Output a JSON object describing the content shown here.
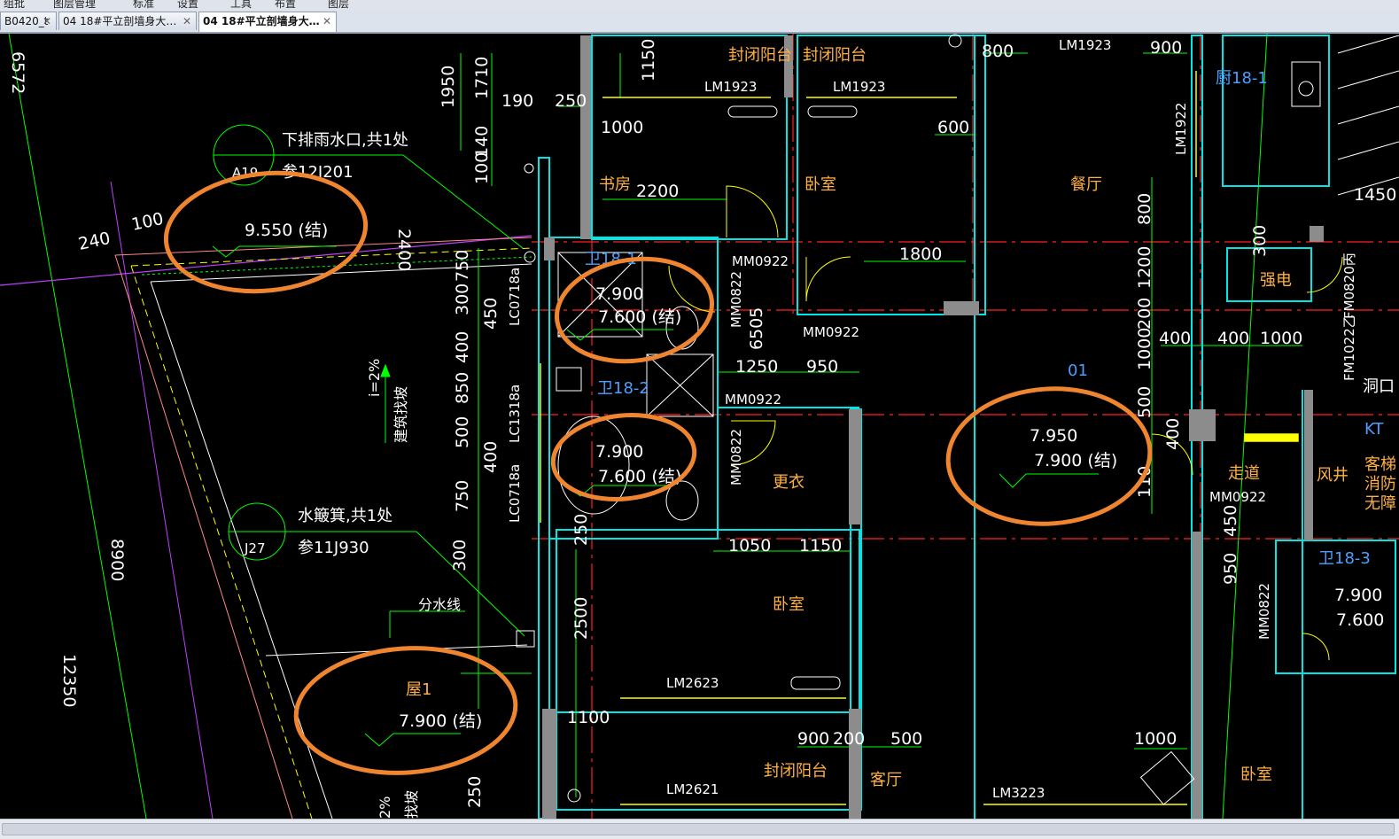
{
  "menu": [
    "组批",
    "图层管理",
    "标准",
    "设置",
    "工具",
    "布置",
    "图层"
  ],
  "tabs": [
    {
      "label": "B0420_t"
    },
    {
      "label": "04 18#平立剖墙身大…"
    },
    {
      "label": "04 18#平立剖墙身大…"
    }
  ],
  "tab_close_glyph": "✕",
  "drawing": {
    "dims": {
      "d6572": "6572",
      "d1950": "1950",
      "d1710": "1710",
      "d190": "190",
      "d250a": "250",
      "d1150": "1150",
      "d1000a": "1000",
      "d140": "140",
      "d100a": "100",
      "d2200": "2200",
      "d240": "240",
      "d100b": "100",
      "d2400": "2400",
      "d750a": "750",
      "d300a": "300",
      "d450": "450",
      "d400a": "400",
      "d850": "850",
      "d500a": "500",
      "d400b": "400",
      "d750b": "750",
      "d8900": "8900",
      "d12350": "12350",
      "d300b": "300",
      "d250b": "250",
      "d2500": "2500",
      "d1100": "1100",
      "d250c": "250",
      "d6505": "6505",
      "d1250": "1250",
      "d950a": "950",
      "d1800": "1800",
      "d800a": "800",
      "d900a": "900",
      "d600": "600",
      "d800b": "800",
      "d1200": "1200",
      "d200": "200",
      "d1000b": "1000",
      "d500b": "500",
      "d400c": "400",
      "d400d": "400",
      "d1000c": "1000",
      "d400e": "400",
      "d110": "110",
      "d1050": "1050",
      "d1150b": "1150",
      "d900b": "900",
      "d200b": "200",
      "d500c": "500",
      "d1000d": "1000",
      "d1450": "1450",
      "d450b": "450",
      "d950b": "950",
      "d300c": "300"
    },
    "doors": {
      "lm1923a": "LM1923",
      "lm1923b": "LM1923",
      "lm1923c": "LM1923",
      "mm0922a": "MM0922",
      "mm0922b": "MM0922",
      "mm0922c": "MM0922",
      "mm0922d": "MM0922",
      "mm0822a": "MM0822",
      "mm0822b": "MM0822",
      "mm0822c": "MM0822",
      "lc0718a": "LC0718a",
      "lc1318a": "LC1318a",
      "lc0718b": "LC0718a",
      "lm2623": "LM2623",
      "lm2621": "LM2621",
      "lm3223": "LM3223",
      "lm1922": "LM1922",
      "fm0820": "FM0820丙",
      "fm1022": "FM1022乙"
    },
    "rooms": {
      "balcony1": "封闭阳台",
      "balcony2": "封闭阳台",
      "balcony3": "封闭阳台",
      "study": "书房",
      "bedroom1": "卧室",
      "dining": "餐厅",
      "dressing": "更衣",
      "bedroom2": "卧室",
      "living": "客厅",
      "corridor": "走道",
      "bedroom3": "卧室",
      "power": "强电",
      "windwell": "风井",
      "kitchen": "厨18-1",
      "wc1": "卫18-1",
      "wc2": "卫18-2",
      "wc3": "卫18-3",
      "unit": "01",
      "kt": "KT",
      "fire": "消防",
      "shaft": "洞口",
      "roof": "屋1"
    },
    "notes": {
      "drain_title": "下排雨水口,共1处",
      "drain_code": "A19",
      "drain_ref": "参12J201",
      "box_title": "水簸箕,共1处",
      "box_code": "J27",
      "box_ref": "参11J930",
      "slope": "i=2%",
      "slope_text": "建筑找坡",
      "divide": "分水线",
      "slope2": "2%",
      "slope2_text": "找坡",
      "side1": "客梯",
      "side2": "无障"
    },
    "levels": {
      "l9550": "9.550 (结)",
      "wc1_top": "7.900",
      "wc1_bot": "7.600 (结)",
      "wc2_top": "7.900",
      "wc2_bot": "7.600 (结)",
      "main_top": "7.950",
      "main_bot": "7.900 (结)",
      "roof": "7.900 (结)",
      "wc3_top": "7.900",
      "wc3_bot": "7.600"
    },
    "colors": {
      "wall": "#00e5e5",
      "axis": "#ff2020",
      "dim": "#00ff00",
      "text": "#ffffff",
      "room": "#ffb040",
      "door": "#ffff00",
      "highlight": "#f08530",
      "purple": "#c040ff"
    }
  }
}
